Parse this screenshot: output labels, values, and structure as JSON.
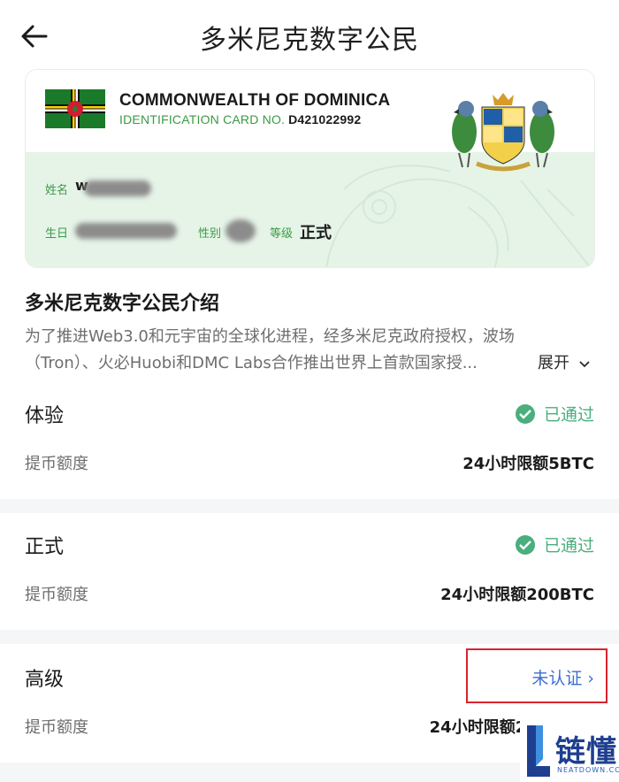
{
  "header": {
    "title": "多米尼克数字公民"
  },
  "card": {
    "country": "COMMONWEALTH OF DOMINICA",
    "id_label": "IDENTIFICATION CARD NO.",
    "id_number": "D421022992",
    "name_label": "姓名",
    "birth_label": "生日",
    "gender_label": "性别",
    "level_label": "等级",
    "level_value": "正式",
    "name_initial": "w"
  },
  "intro": {
    "title": "多米尼克数字公民介绍",
    "line1": "为了推进Web3.0和元宇宙的全球化进程，经多米尼克政府授权，波场",
    "line2": "（Tron）、火必Huobi和DMC Labs合作推出世界上首款国家授...",
    "expand_label": "展开"
  },
  "levels": [
    {
      "name": "体验",
      "status": "已通过",
      "row_label": "提币额度",
      "row_value": "24小时限额5BTC"
    },
    {
      "name": "正式",
      "status": "已通过",
      "row_label": "提币额度",
      "row_value": "24小时限额200BTC"
    },
    {
      "name": "高级",
      "status": "未认证 ›",
      "row_label": "提币额度",
      "row_value": "24小时限额2000BTC"
    }
  ],
  "logo": {
    "text": "链懂",
    "sub": "NEATDOWN.COM"
  },
  "colors": {
    "green": "#4aae7d",
    "blue": "#3b6fd1",
    "red_highlight": "#d9232d"
  }
}
